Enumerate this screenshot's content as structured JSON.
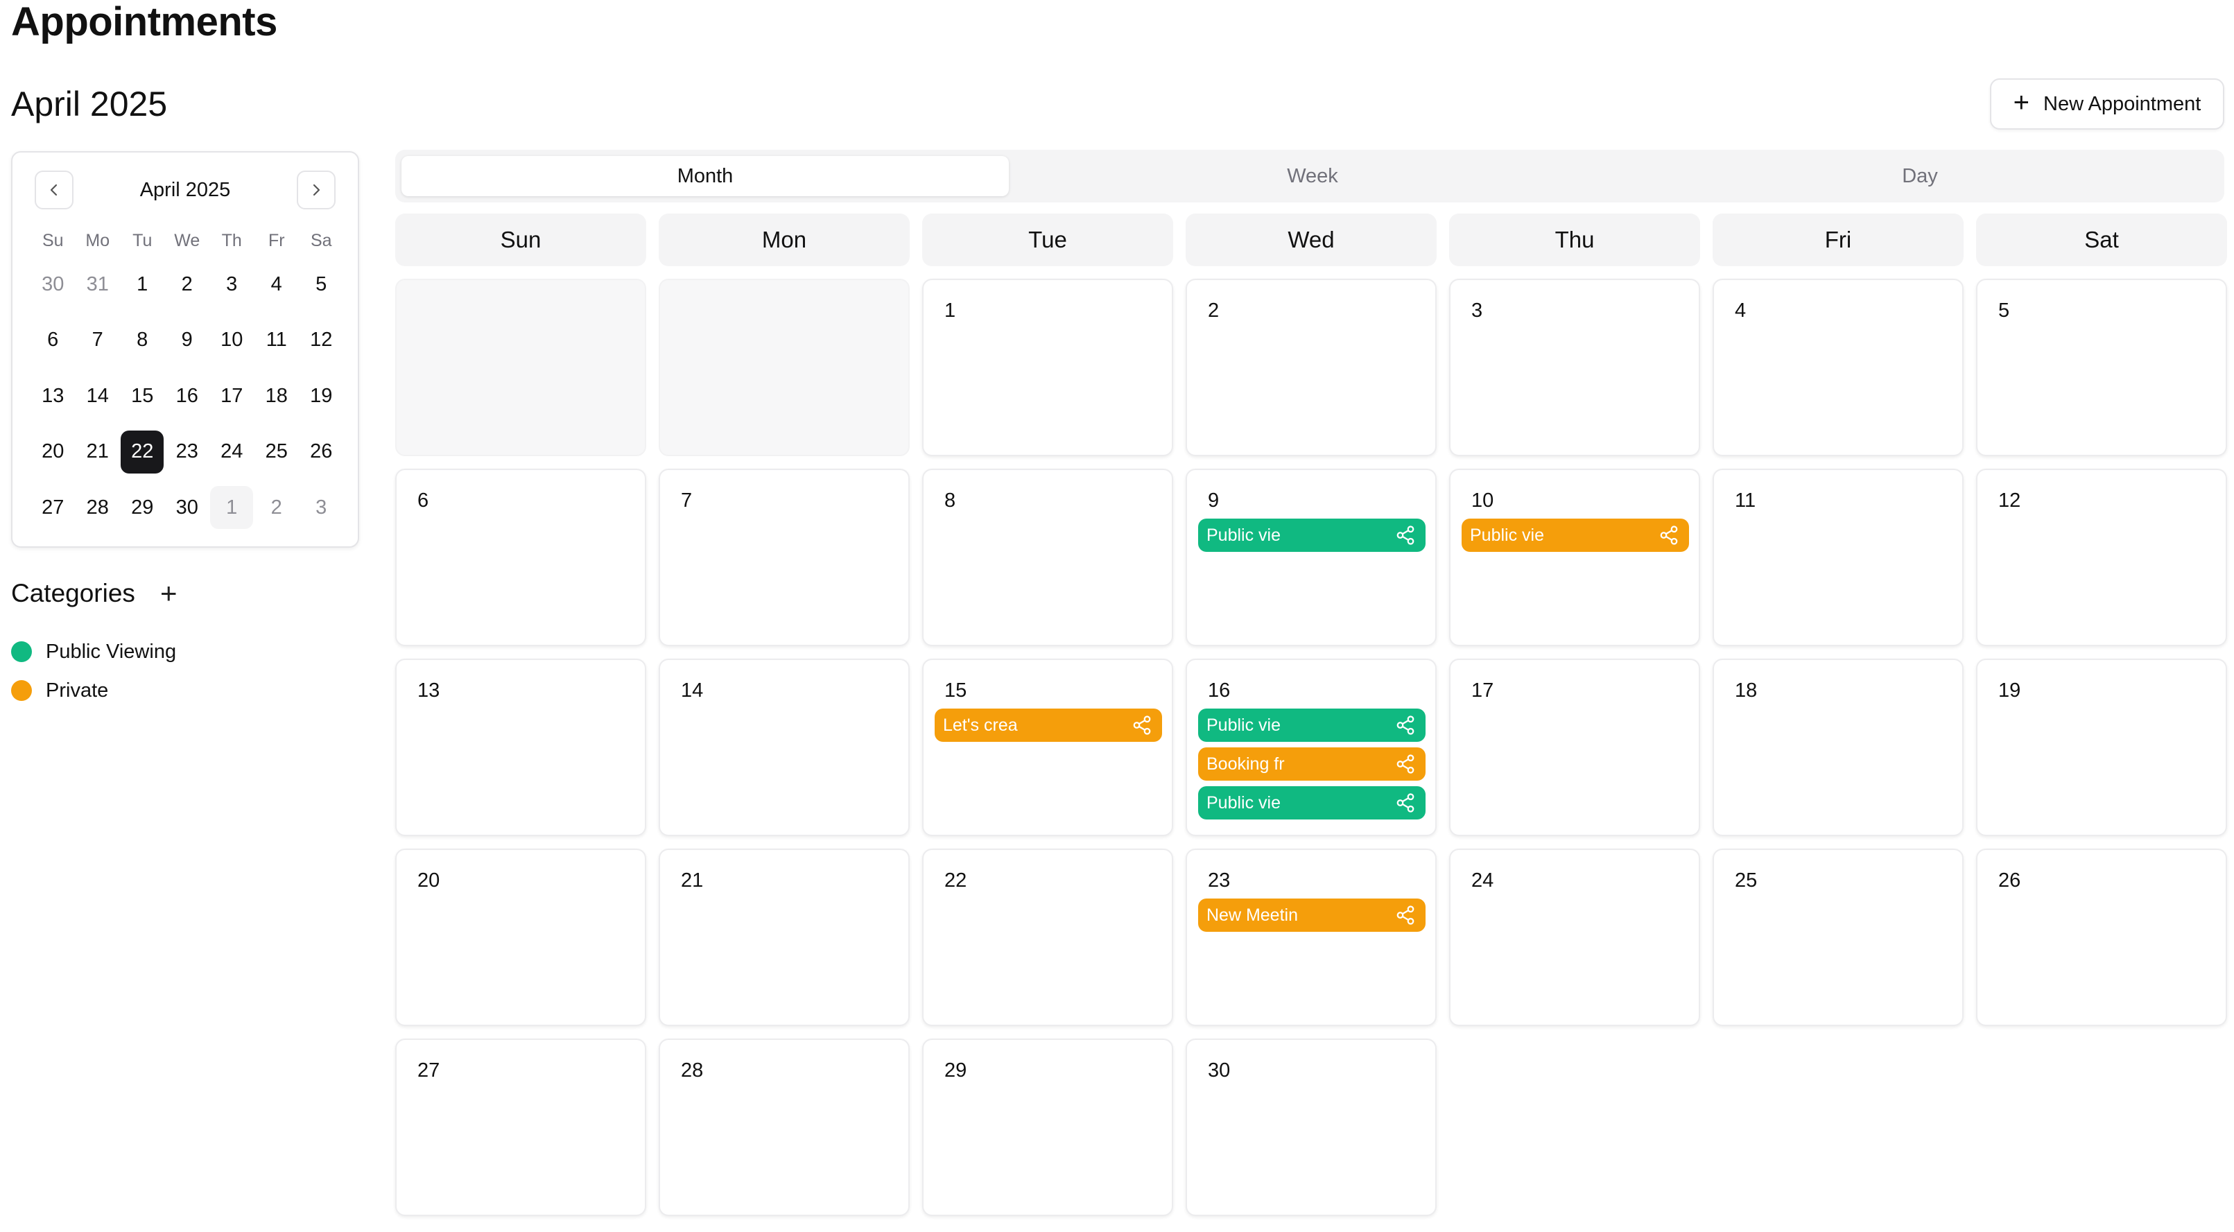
{
  "page": {
    "title": "Appointments",
    "month_title": "April 2025",
    "new_button_label": "New Appointment"
  },
  "colors": {
    "public_viewing": "#10b981",
    "private": "#f59e0b",
    "selected_day": "#18181b"
  },
  "mini_calendar": {
    "title": "April 2025",
    "prev_icon": "chevron-left-icon",
    "next_icon": "chevron-right-icon",
    "weekdays": [
      "Su",
      "Mo",
      "Tu",
      "We",
      "Th",
      "Fr",
      "Sa"
    ],
    "weeks": [
      [
        {
          "d": "30",
          "out": true
        },
        {
          "d": "31",
          "out": true
        },
        {
          "d": "1"
        },
        {
          "d": "2"
        },
        {
          "d": "3"
        },
        {
          "d": "4"
        },
        {
          "d": "5"
        }
      ],
      [
        {
          "d": "6"
        },
        {
          "d": "7"
        },
        {
          "d": "8"
        },
        {
          "d": "9"
        },
        {
          "d": "10"
        },
        {
          "d": "11"
        },
        {
          "d": "12"
        }
      ],
      [
        {
          "d": "13"
        },
        {
          "d": "14"
        },
        {
          "d": "15"
        },
        {
          "d": "16"
        },
        {
          "d": "17"
        },
        {
          "d": "18"
        },
        {
          "d": "19"
        }
      ],
      [
        {
          "d": "20"
        },
        {
          "d": "21"
        },
        {
          "d": "22",
          "selected": true
        },
        {
          "d": "23"
        },
        {
          "d": "24"
        },
        {
          "d": "25"
        },
        {
          "d": "26"
        }
      ],
      [
        {
          "d": "27"
        },
        {
          "d": "28"
        },
        {
          "d": "29"
        },
        {
          "d": "30"
        },
        {
          "d": "1",
          "out": true,
          "highlight": true
        },
        {
          "d": "2",
          "out": true
        },
        {
          "d": "3",
          "out": true
        }
      ]
    ]
  },
  "categories": {
    "title": "Categories",
    "add_icon": "plus-icon",
    "items": [
      {
        "label": "Public Viewing",
        "color": "#10b981"
      },
      {
        "label": "Private",
        "color": "#f59e0b"
      }
    ]
  },
  "view_tabs": [
    {
      "label": "Month",
      "active": true
    },
    {
      "label": "Week",
      "active": false
    },
    {
      "label": "Day",
      "active": false
    }
  ],
  "calendar": {
    "weekdays": [
      "Sun",
      "Mon",
      "Tue",
      "Wed",
      "Thu",
      "Fri",
      "Sat"
    ],
    "weeks": [
      [
        {
          "d": ""
        },
        {
          "d": ""
        },
        {
          "d": "1"
        },
        {
          "d": "2"
        },
        {
          "d": "3"
        },
        {
          "d": "4"
        },
        {
          "d": "5"
        }
      ],
      [
        {
          "d": "6"
        },
        {
          "d": "7"
        },
        {
          "d": "8"
        },
        {
          "d": "9",
          "events": [
            {
              "title": "Public vie",
              "category": "public"
            }
          ]
        },
        {
          "d": "10",
          "events": [
            {
              "title": "Public vie",
              "category": "private"
            }
          ]
        },
        {
          "d": "11"
        },
        {
          "d": "12"
        }
      ],
      [
        {
          "d": "13"
        },
        {
          "d": "14"
        },
        {
          "d": "15",
          "events": [
            {
              "title": "Let's crea",
              "category": "private"
            }
          ]
        },
        {
          "d": "16",
          "events": [
            {
              "title": "Public vie",
              "category": "public"
            },
            {
              "title": "Booking fr",
              "category": "private"
            },
            {
              "title": "Public vie",
              "category": "public"
            }
          ]
        },
        {
          "d": "17"
        },
        {
          "d": "18"
        },
        {
          "d": "19"
        }
      ],
      [
        {
          "d": "20"
        },
        {
          "d": "21"
        },
        {
          "d": "22"
        },
        {
          "d": "23",
          "events": [
            {
              "title": "New Meetin",
              "category": "private"
            }
          ]
        },
        {
          "d": "24"
        },
        {
          "d": "25"
        },
        {
          "d": "26"
        }
      ],
      [
        {
          "d": "27"
        },
        {
          "d": "28"
        },
        {
          "d": "29"
        },
        {
          "d": "30"
        }
      ]
    ]
  }
}
